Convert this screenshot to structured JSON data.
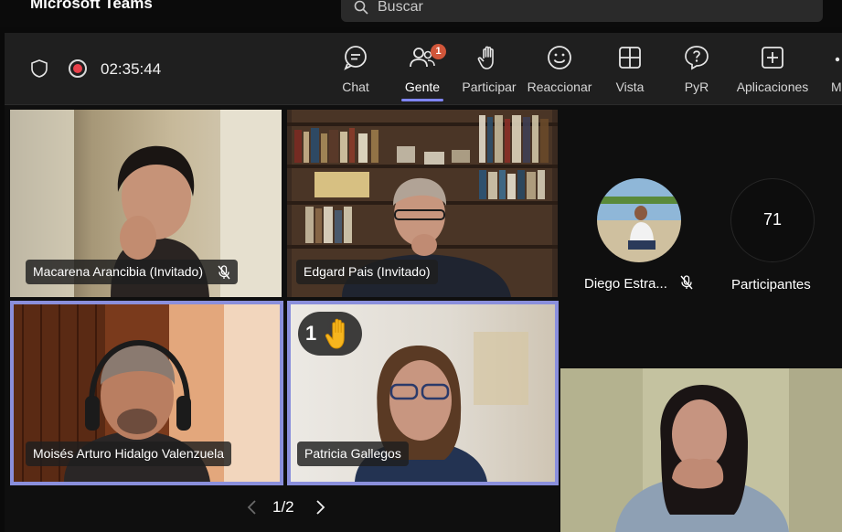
{
  "app": {
    "title": "Microsoft Teams"
  },
  "search": {
    "placeholder": "Buscar"
  },
  "meeting": {
    "timer": "02:35:44"
  },
  "toolbar": [
    {
      "label": "Chat",
      "icon": "chat-icon"
    },
    {
      "label": "Gente",
      "icon": "people-icon",
      "badge": "1",
      "active": true
    },
    {
      "label": "Participar",
      "icon": "raise-hand-icon"
    },
    {
      "label": "Reaccionar",
      "icon": "smiley-icon"
    },
    {
      "label": "Vista",
      "icon": "grid-icon"
    },
    {
      "label": "PyR",
      "icon": "qna-icon"
    },
    {
      "label": "Aplicaciones",
      "icon": "add-app-icon"
    },
    {
      "label": "M",
      "icon": "more-icon"
    }
  ],
  "tiles": [
    {
      "name": "Macarena Arancibia (Invitado)",
      "muted": true
    },
    {
      "name": "Edgard Pais (Invitado)",
      "muted": false
    },
    {
      "name": "Moisés Arturo Hidalgo Valenzuela",
      "muted": false,
      "speaking": true
    },
    {
      "name": "Patricia Gallegos",
      "muted": false,
      "speaking": true,
      "hand_raised_order": "1"
    }
  ],
  "pager": {
    "text": "1/2"
  },
  "side": {
    "participant_name": "Diego Estra...",
    "participant_muted": true,
    "participants_count": "71",
    "participants_label": "Participantes"
  },
  "colors": {
    "accent": "#7f85f5",
    "speaking_border": "#8a8fdc",
    "badge": "#d1563a",
    "recording": "#e8404a"
  }
}
